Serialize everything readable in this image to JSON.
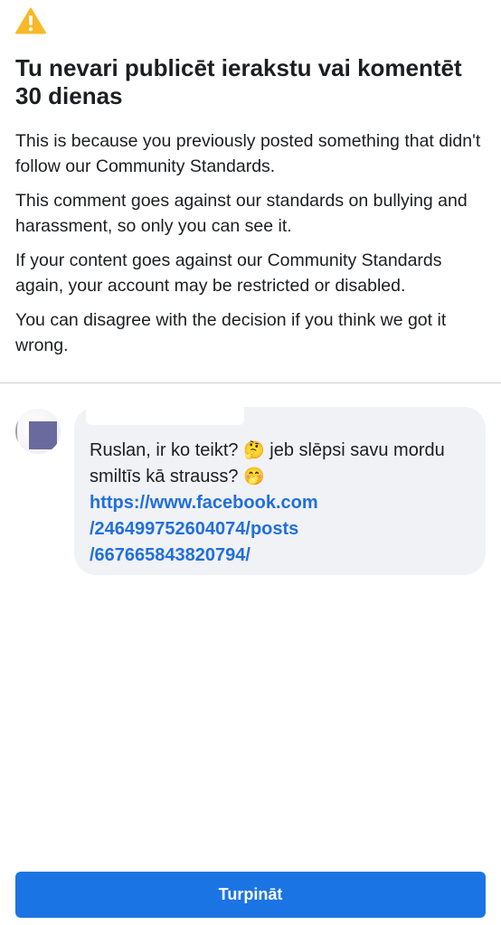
{
  "dialog": {
    "warning_icon": "warning-triangle-icon",
    "title": "Tu nevari publicēt ierakstu vai komentēt 30 dienas",
    "paragraphs": [
      "This is because you previously posted something that didn't follow our Community Standards.",
      "This comment goes against our standards on bullying and harassment, so only you can see it.",
      "If your content goes against our Community Standards again, your account may be restricted or disabled.",
      "You can disagree with the decision if you think we got it wrong."
    ]
  },
  "comment": {
    "text_part1": "Ruslan,  ir ko teikt? ",
    "emoji1": "🤔",
    "text_part2": " jeb slēpsi savu mordu smiltīs kā strauss? ",
    "emoji2": "🤭",
    "link_lines": [
      "https://www.facebook.com",
      "/246499752604074/posts",
      "/667665843820794/"
    ]
  },
  "footer": {
    "continue_label": "Turpināt"
  },
  "colors": {
    "primary": "#1b74e4",
    "link": "#216fdb",
    "warning": "#f7b928",
    "bubble": "#f0f2f5"
  }
}
